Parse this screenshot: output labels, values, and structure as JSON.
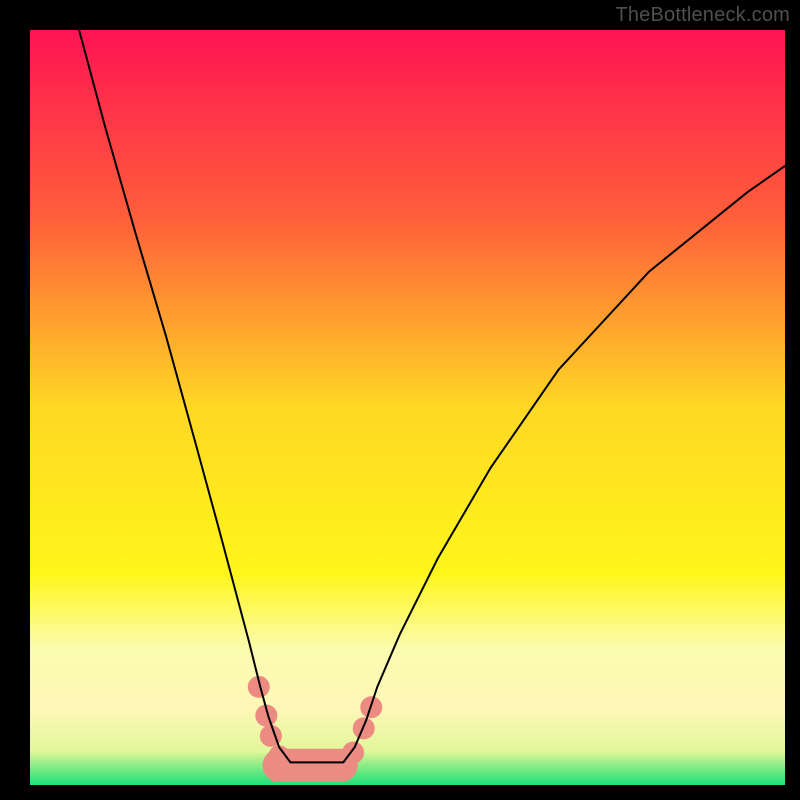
{
  "watermark": "TheBottleneck.com",
  "chart_data": {
    "type": "line",
    "title": "",
    "xlabel": "",
    "ylabel": "",
    "xlim": [
      0,
      100
    ],
    "ylim": [
      0,
      100
    ],
    "grid": false,
    "legend": false,
    "background_gradient": {
      "stops": [
        {
          "offset": 0.0,
          "color": "#ff1453"
        },
        {
          "offset": 0.25,
          "color": "#ff5f3a"
        },
        {
          "offset": 0.5,
          "color": "#ffd824"
        },
        {
          "offset": 0.72,
          "color": "#fff61a"
        },
        {
          "offset": 0.82,
          "color": "#fcfcb0"
        },
        {
          "offset": 0.9,
          "color": "#fdf7b6"
        },
        {
          "offset": 0.955,
          "color": "#e2f79b"
        },
        {
          "offset": 0.975,
          "color": "#86ec86"
        },
        {
          "offset": 1.0,
          "color": "#1fe07a"
        }
      ]
    },
    "series": [
      {
        "name": "curve",
        "color": "#000000",
        "stroke_width": 2,
        "x": [
          6.5,
          10,
          14,
          18,
          22,
          25,
          27,
          29,
          30.5,
          31.6,
          33,
          34.5,
          41.5,
          43,
          44.5,
          46,
          49,
          54,
          61,
          70,
          82,
          95,
          100
        ],
        "y": [
          100,
          87,
          73,
          59.5,
          45,
          34,
          26.5,
          19,
          13,
          9,
          5,
          3,
          3,
          5,
          8.5,
          13,
          20,
          30,
          42,
          55,
          68,
          78.5,
          82
        ]
      }
    ],
    "markers": {
      "color": "#eb8b82",
      "radius_px": 11,
      "capsule": {
        "cx1": 33.0,
        "cx2": 41.2,
        "cy": 2.6,
        "r": 2.2
      },
      "points": [
        {
          "x": 30.3,
          "y": 13.0
        },
        {
          "x": 31.3,
          "y": 9.2
        },
        {
          "x": 31.9,
          "y": 6.5
        },
        {
          "x": 33.0,
          "y": 3.8
        },
        {
          "x": 34.6,
          "y": 2.6
        },
        {
          "x": 41.2,
          "y": 2.9
        },
        {
          "x": 42.8,
          "y": 4.3
        },
        {
          "x": 44.2,
          "y": 7.5
        },
        {
          "x": 45.2,
          "y": 10.3
        }
      ]
    }
  }
}
